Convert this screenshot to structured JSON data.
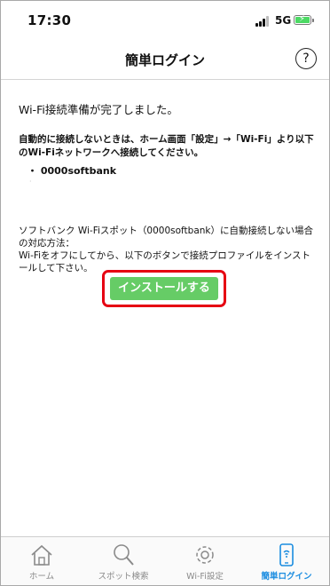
{
  "status_bar": {
    "time": "17:30",
    "network": "5G"
  },
  "header": {
    "title": "簡単ログイン",
    "help_label": "?"
  },
  "content": {
    "complete_message": "Wi-Fi接続準備が完了しました。",
    "auto_connect_note": "自動的に接続しないときは、ホーム画面「設定」→「Wi-Fi」より以下のWi-Fiネットワークへ接続してください。",
    "ssid_item": "・ 0000softbank",
    "spot_message_line1": "ソフトバンク Wi-Fiスポット（0000softbank）に自動接続しない場合の対応方法：",
    "spot_message_line2": "Wi-Fiをオフにしてから、以下のボタンで接続プロファイルをインストールして下さい。",
    "install_button": "インストールする"
  },
  "tabs": [
    {
      "label": "ホーム",
      "icon": "home-icon",
      "active": false
    },
    {
      "label": "スポット検索",
      "icon": "search-icon",
      "active": false
    },
    {
      "label": "Wi-Fi設定",
      "icon": "gear-icon",
      "active": false
    },
    {
      "label": "簡単ログイン",
      "icon": "phone-login-icon",
      "active": true
    }
  ],
  "colors": {
    "accent": "#1a8ce0",
    "button": "#66cc66",
    "highlight": "#e60012"
  }
}
